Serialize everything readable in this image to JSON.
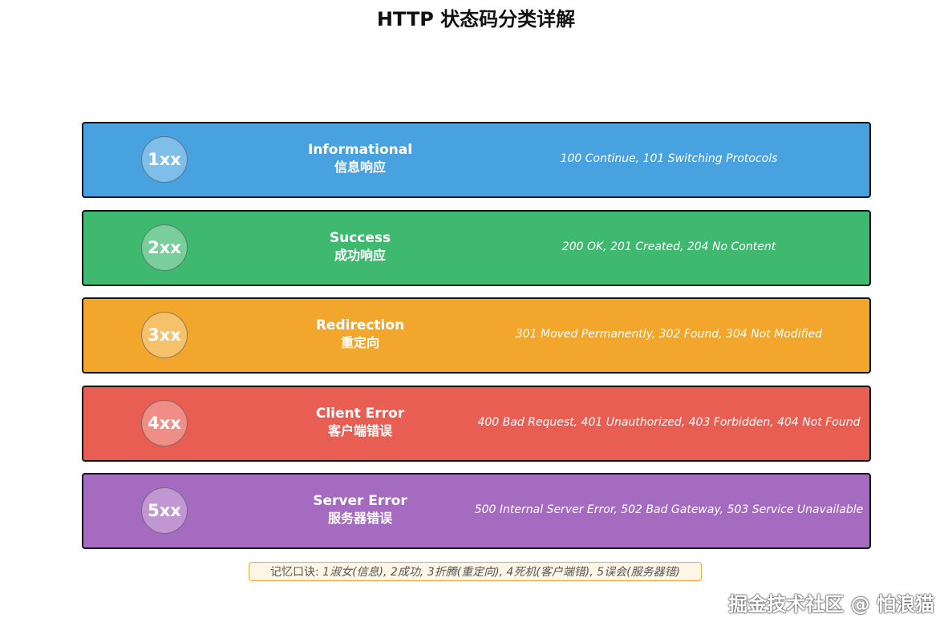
{
  "title": "HTTP 状态码分类详解",
  "categories": [
    {
      "code": "1xx",
      "name": "Informational",
      "name_zh": "信息响应",
      "examples": "100 Continue, 101 Switching Protocols",
      "color": "#48a2e0"
    },
    {
      "code": "2xx",
      "name": "Success",
      "name_zh": "成功响应",
      "examples": "200 OK, 201 Created, 204 No Content",
      "color": "#3fb970"
    },
    {
      "code": "3xx",
      "name": "Redirection",
      "name_zh": "重定向",
      "examples": "301 Moved Permanently, 302 Found, 304 Not Modified",
      "color": "#f2a62b"
    },
    {
      "code": "4xx",
      "name": "Client Error",
      "name_zh": "客户端错误",
      "examples": "400 Bad Request, 401 Unauthorized, 403 Forbidden, 404 Not Found",
      "color": "#e85e52"
    },
    {
      "code": "5xx",
      "name": "Server Error",
      "name_zh": "服务器错误",
      "examples": "500 Internal Server Error, 502 Bad Gateway, 503 Service Unavailable",
      "color": "#a56bc1"
    }
  ],
  "mnemonic": {
    "label": "记忆口诀: ",
    "text": "1淑女(信息), 2成功, 3折腾(重定向), 4死机(客户端错), 5误会(服务器错)"
  },
  "watermark": "掘金技术社区 @ 怕浪猫"
}
